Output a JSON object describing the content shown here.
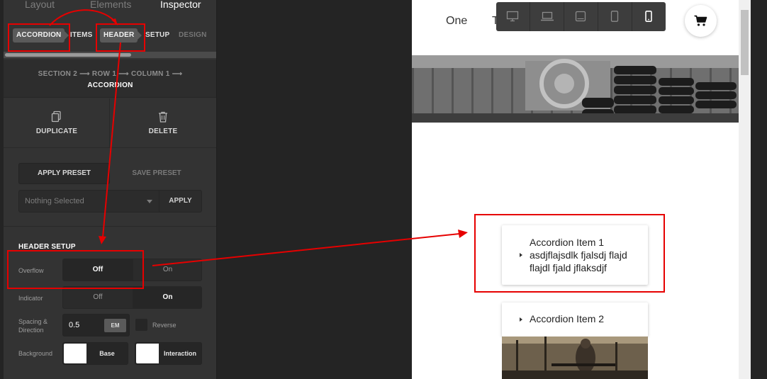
{
  "panel": {
    "top_tabs": [
      "Layout",
      "Elements",
      "Inspector"
    ],
    "sub_tabs": [
      "ACCORDION",
      "ITEMS",
      "HEADER",
      "SETUP",
      "DESIGN"
    ],
    "breadcrumb_path": "SECTION 2 ⟶ ROW 1 ⟶ COLUMN 1 ⟶",
    "breadcrumb_current": "ACCORDION",
    "duplicate": "DUPLICATE",
    "delete": "DELETE",
    "apply_preset": "APPLY PRESET",
    "save_preset": "SAVE PRESET",
    "preset_select": "Nothing Selected",
    "apply": "APPLY",
    "section_title": "HEADER SETUP",
    "overflow": {
      "label": "Overflow",
      "off": "Off",
      "on": "On",
      "selected": "Off"
    },
    "indicator": {
      "label": "Indicator",
      "off": "Off",
      "on": "On",
      "selected": "On"
    },
    "spacing": {
      "label": "Spacing & Direction",
      "value": "0.5",
      "unit": "EM",
      "reverse": "Reverse"
    },
    "background": {
      "label": "Background",
      "base": "Base",
      "interaction": "Interaction"
    }
  },
  "preview": {
    "nav_partial": "One",
    "nav_partial_2": "T",
    "accordion": [
      {
        "title": "Accordion Item 1",
        "body": "asdjflajsdlk fjalsdj flajd flajdl fjald jflaksdjf"
      },
      {
        "title": "Accordion Item 2"
      }
    ],
    "devices": [
      "desktop-icon",
      "laptop-icon",
      "tablet-landscape-icon",
      "tablet-portrait-icon",
      "mobile-icon"
    ]
  },
  "colors": {
    "annotation": "#e60000",
    "panel_bg": "#333333"
  }
}
